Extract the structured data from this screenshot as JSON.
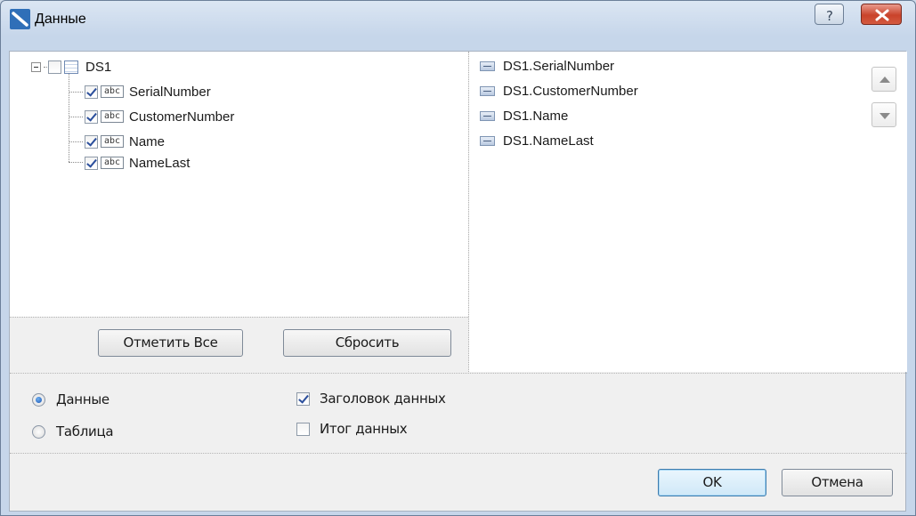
{
  "window": {
    "title": "Данные",
    "help_symbol": "?",
    "close_symbol": "×"
  },
  "tree": {
    "root": {
      "label": "DS1",
      "checked": false,
      "expanded": true
    },
    "fields": [
      {
        "type_badge": "abc",
        "label": "SerialNumber",
        "checked": true
      },
      {
        "type_badge": "abc",
        "label": "CustomerNumber",
        "checked": true
      },
      {
        "type_badge": "abc",
        "label": "Name",
        "checked": true
      },
      {
        "type_badge": "abc",
        "label": "NameLast",
        "checked": true
      }
    ]
  },
  "tree_buttons": {
    "select_all": "Отметить Все",
    "reset": "Сбросить"
  },
  "selected_fields": [
    "DS1.SerialNumber",
    "DS1.CustomerNumber",
    "DS1.Name",
    "DS1.NameLast"
  ],
  "options": {
    "mode": [
      {
        "label": "Данные",
        "selected": true
      },
      {
        "label": "Таблица",
        "selected": false
      }
    ],
    "flags": [
      {
        "label": "Заголовок данных",
        "checked": true
      },
      {
        "label": "Итог данных",
        "checked": false
      }
    ]
  },
  "footer": {
    "ok": "OK",
    "cancel": "Отмена"
  }
}
